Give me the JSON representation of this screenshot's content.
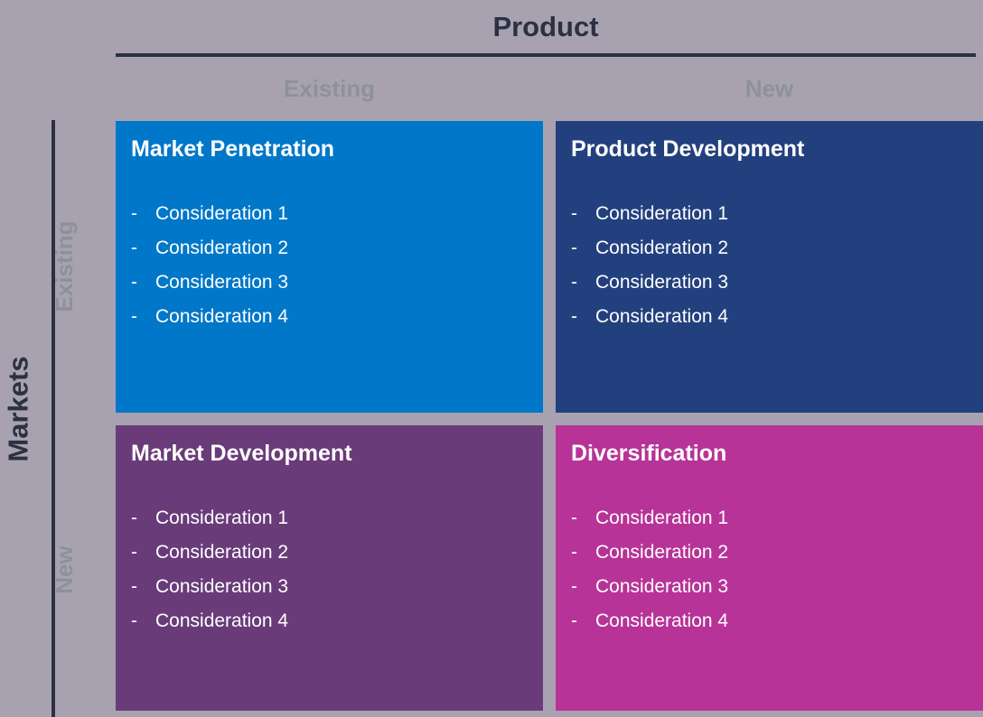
{
  "axes": {
    "horizontal": {
      "title": "Product",
      "columns": [
        "Existing",
        "New"
      ]
    },
    "vertical": {
      "title": "Markets",
      "rows": [
        "Existing",
        "New"
      ]
    }
  },
  "bullet_marker": "-",
  "quadrants": [
    {
      "id": "market-penetration",
      "title": "Market Penetration",
      "color": "#0077c8",
      "items": [
        "Consideration 1",
        "Consideration 2",
        "Consideration 3",
        "Consideration 4"
      ]
    },
    {
      "id": "product-development",
      "title": "Product Development",
      "color": "#23407e",
      "items": [
        "Consideration 1",
        "Consideration 2",
        "Consideration 3",
        "Consideration 4"
      ]
    },
    {
      "id": "market-development",
      "title": "Market Development",
      "color": "#693b79",
      "items": [
        "Consideration 1",
        "Consideration 2",
        "Consideration 3",
        "Consideration 4"
      ]
    },
    {
      "id": "diversification",
      "title": "Diversification",
      "color": "#b73397",
      "items": [
        "Consideration 1",
        "Consideration 2",
        "Consideration 3",
        "Consideration 4"
      ]
    }
  ],
  "colors": {
    "background": "#a8a2b0",
    "axis_line": "#2b3142",
    "axis_title": "#2b3142",
    "axis_subtitle": "#8d919b",
    "quadrant_text": "#ffffff"
  }
}
